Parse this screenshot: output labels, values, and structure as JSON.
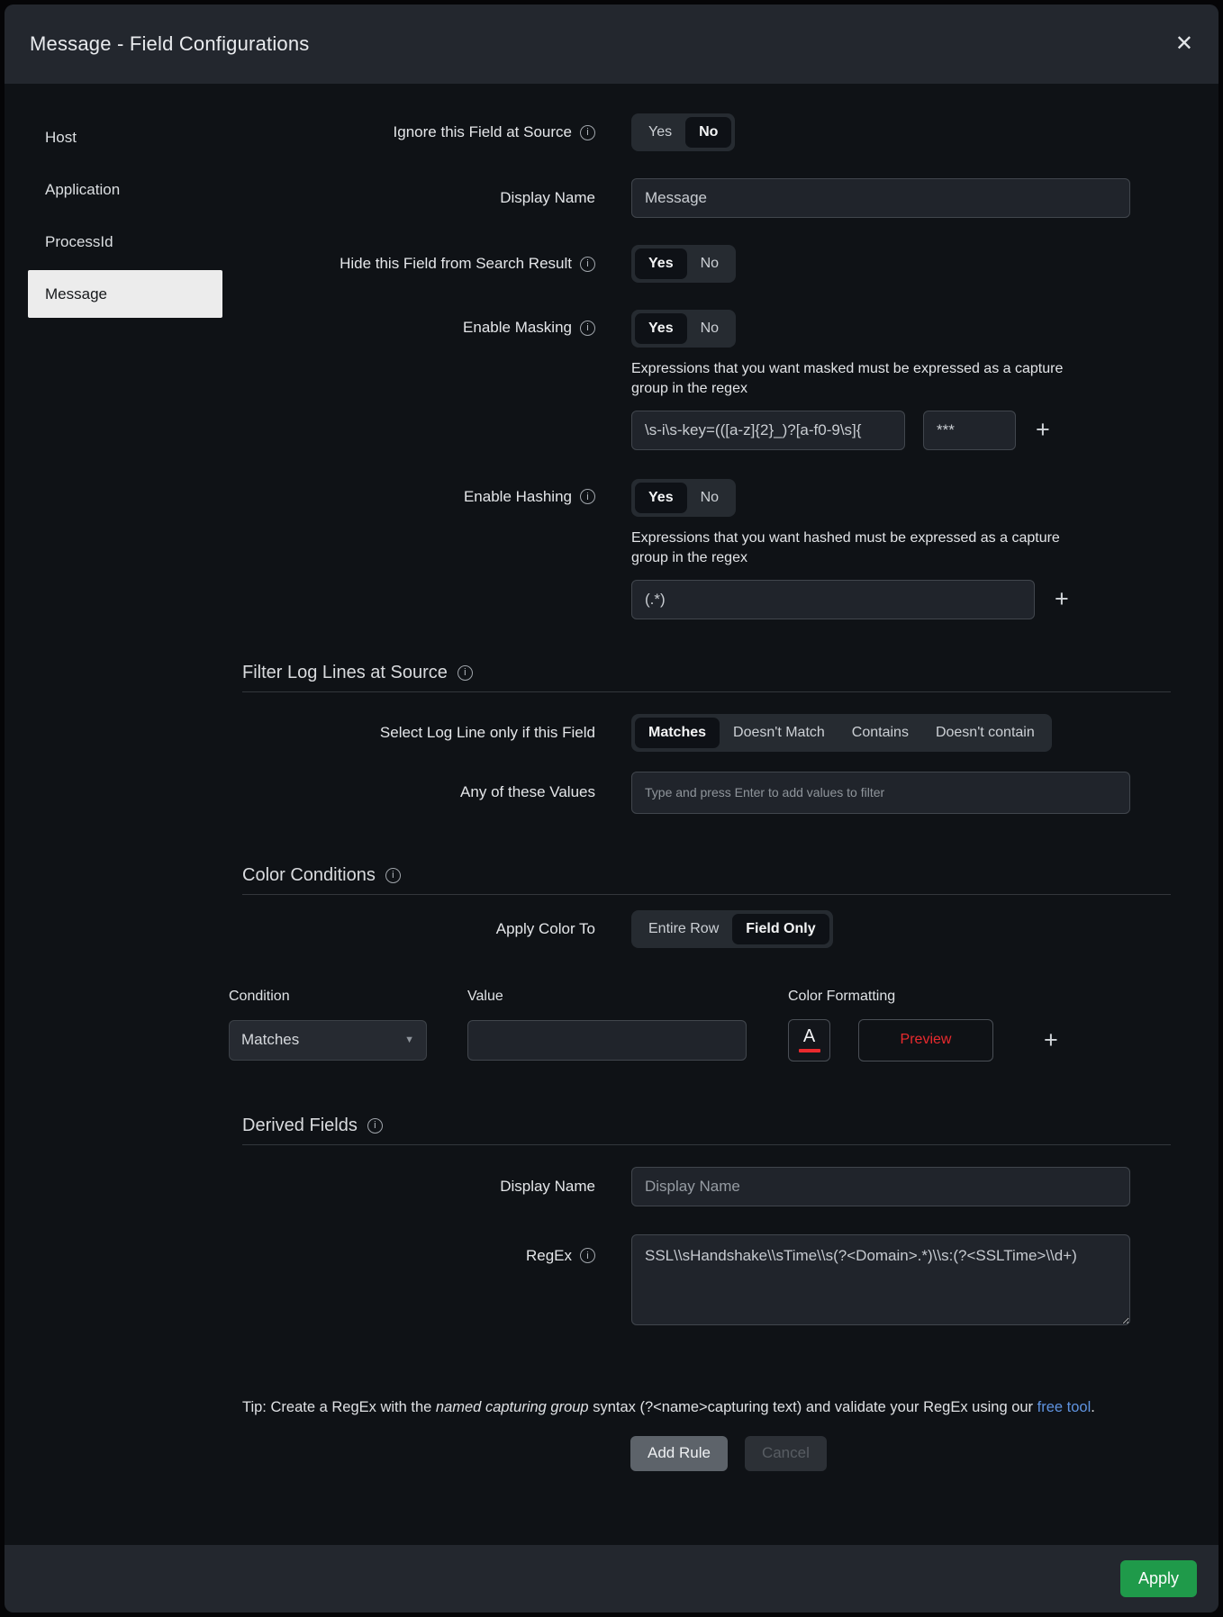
{
  "modal": {
    "title": "Message - Field Configurations"
  },
  "icons": {
    "close": "✕",
    "info": "i",
    "plus": "+",
    "caret": "▼"
  },
  "toggle": {
    "yes": "Yes",
    "no": "No"
  },
  "sidebar": {
    "items": [
      {
        "label": "Host"
      },
      {
        "label": "Application"
      },
      {
        "label": "ProcessId"
      },
      {
        "label": "Message"
      }
    ]
  },
  "form": {
    "ignore_field": {
      "label": "Ignore this Field at Source",
      "selected": "No"
    },
    "display_name": {
      "label": "Display Name",
      "value": "Message"
    },
    "hide_field": {
      "label": "Hide this Field from Search Result",
      "selected": "Yes"
    },
    "masking": {
      "label": "Enable Masking",
      "selected": "Yes",
      "helper": "Expressions that you want masked must be expressed as a capture group in the regex",
      "regex_value": "\\s-i\\s-key=(([a-z]{2}_)?[a-f0-9\\s]{",
      "mask_value": "***"
    },
    "hashing": {
      "label": "Enable Hashing",
      "selected": "Yes",
      "helper": "Expressions that you want hashed must be expressed as a capture group in the regex",
      "regex_value": "(.*)"
    }
  },
  "filter": {
    "title": "Filter Log Lines at Source",
    "match_label": "Select Log Line only if this Field",
    "options": [
      "Matches",
      "Doesn't Match",
      "Contains",
      "Doesn't contain"
    ],
    "selected_option": "Matches",
    "values_label": "Any of these Values",
    "values_placeholder": "Type and press Enter to add values to filter"
  },
  "color": {
    "title": "Color Conditions",
    "apply_label": "Apply Color To",
    "apply_options": [
      "Entire Row",
      "Field Only"
    ],
    "selected_apply": "Field Only",
    "condition_label": "Condition",
    "condition_value": "Matches",
    "value_label": "Value",
    "value_current": "",
    "formatting_label": "Color Formatting",
    "font_letter": "A",
    "preview_label": "Preview",
    "accent_red": "#ea2a2e"
  },
  "derived": {
    "title": "Derived Fields",
    "display_name_label": "Display Name",
    "display_name_placeholder": "Display Name",
    "regex_label": "RegEx",
    "regex_value": "SSL\\\\sHandshake\\\\sTime\\\\s(?<Domain>.*)\\\\s:(?<SSLTime>\\\\d+)"
  },
  "tip": {
    "prefix": "Tip: Create a RegEx with the ",
    "italic": "named capturing group",
    "middle": " syntax (?<name>capturing text) and validate your RegEx using our ",
    "link": "free tool",
    "suffix": ".",
    "link_blue": "#5f93e0"
  },
  "actions": {
    "add_rule": "Add Rule",
    "cancel": "Cancel",
    "apply": "Apply",
    "apply_green": "#1f9a4a"
  }
}
